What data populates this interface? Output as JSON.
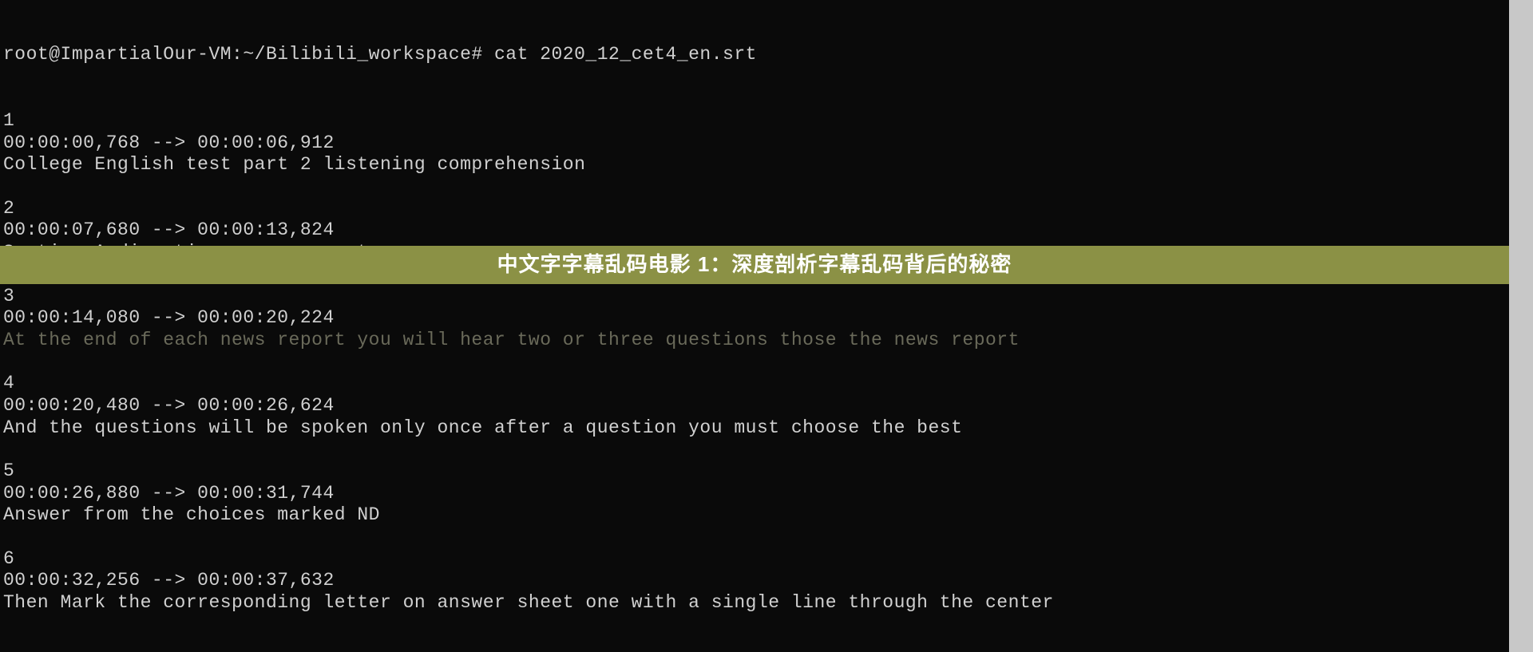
{
  "prompt": "root@ImpartialOur-VM:~/Bilibili_workspace# cat 2020_12_cet4_en.srt",
  "srt_entries": [
    {
      "index": "1",
      "time": "00:00:00,768 --> 00:00:06,912",
      "text": "College English test part 2 listening comprehension"
    },
    {
      "index": "2",
      "time": "00:00:07,680 --> 00:00:13,824",
      "text": "Section A directions news reports"
    },
    {
      "index": "3",
      "time": "00:00:14,080 --> 00:00:20,224",
      "text": "At the end of each news report you will hear two or three questions those the news report",
      "faded": true
    },
    {
      "index": "4",
      "time": "00:00:20,480 --> 00:00:26,624",
      "text": "And the questions will be spoken only once after a question you must choose the best"
    },
    {
      "index": "5",
      "time": "00:00:26,880 --> 00:00:31,744",
      "text": "Answer from the choices marked ND"
    },
    {
      "index": "6",
      "time": "00:00:32,256 --> 00:00:37,632",
      "text": "Then Mark the corresponding letter on answer sheet one with a single line through the center"
    }
  ],
  "overlay": {
    "text": "中文字字幕乱码电影 1：深度剖析字幕乱码背后的秘密"
  }
}
